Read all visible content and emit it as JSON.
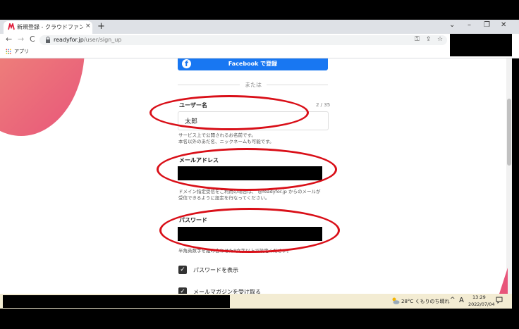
{
  "browser": {
    "tab_title": "新規登録 - クラウドファンディング RE",
    "tab_close": "×",
    "new_tab": "+",
    "window_buttons": [
      "⌄",
      "–",
      "❐",
      "✕"
    ],
    "nav": {
      "back": "←",
      "forward": "→",
      "reload": "C"
    },
    "url_host": "readyfor.jp",
    "url_path": "/user/sign_up",
    "omnibox_icons": [
      "key-icon",
      "share-icon",
      "star-icon"
    ],
    "bookmarks_apps_label": "アプリ"
  },
  "form": {
    "facebook_label": "Facebook で登録",
    "facebook_icon": "f",
    "or_text": "または",
    "username": {
      "label": "ユーザー名",
      "counter": "2 / 35",
      "value": "太郎",
      "help_line1": "サービス上で公開されるお名前です。",
      "help_line2": "本名以外のあだ名、ニックネームも可能です。"
    },
    "email": {
      "label": "メールアドレス",
      "help_line1": "ドメイン指定受信をご利用の場合は、 @readyfor.jp からのメールが",
      "help_line2": "受信できるように設定を行なってください。"
    },
    "password": {
      "label": "パスワード",
      "help_line1": "半角英数字を組み合わせた8文字以上で設定ください。"
    },
    "show_password_label": "パスワードを表示",
    "mail_magazine_label": "メールマガジンを受け取る",
    "check_glyph": "✓"
  },
  "taskbar": {
    "weather": "28°C くもりのち晴れ",
    "caret": "^",
    "ime": "A",
    "time": "13:29",
    "date": "2022/07/04"
  },
  "colors": {
    "facebook": "#1877f2",
    "annotation_red": "#d90f18",
    "brand_red": "#e8557a"
  }
}
